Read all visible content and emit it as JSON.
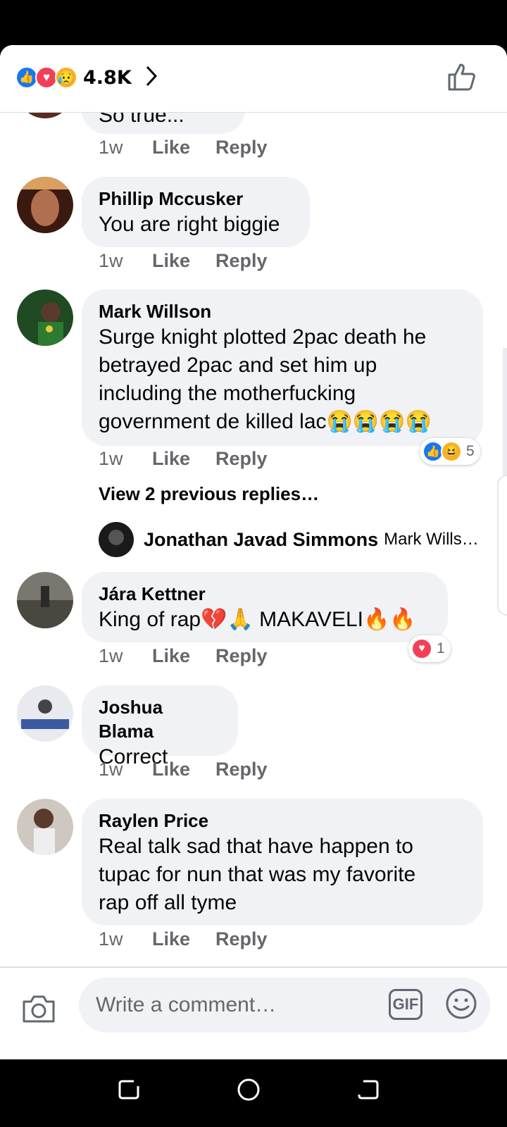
{
  "header": {
    "reaction_count": "4.8K",
    "reactions": [
      "like-icon",
      "love-icon",
      "sad-icon"
    ]
  },
  "comments": [
    {
      "text": "So true...",
      "time": "1w",
      "like": "Like",
      "reply": "Reply"
    },
    {
      "name": "Phillip Mccusker",
      "text": "You are right biggie",
      "time": "1w",
      "like": "Like",
      "reply": "Reply"
    },
    {
      "name": "Mark Willson",
      "text_lines": [
        "Surge knight  plotted 2pac death he",
        "betrayed 2pac and set him up",
        "including the motherfucking",
        "government  de killed lac😭😭😭😭"
      ],
      "time": "1w",
      "like": "Like",
      "reply": "Reply",
      "reaction_count": "5",
      "view_replies": "View 2 previous replies…",
      "reply_preview": {
        "name": "Jonathan Javad Simmons",
        "snippet": "Mark Wills…"
      }
    },
    {
      "name": "Jára Kettner",
      "text": "King of rap💔🙏 MAKAVELI🔥🔥",
      "time": "1w",
      "like": "Like",
      "reply": "Reply",
      "reaction_count": "1"
    },
    {
      "name": "Joshua Blama",
      "text": "Correct",
      "time": "1w",
      "like": "Like",
      "reply": "Reply"
    },
    {
      "name": "Raylen Price",
      "text_lines": [
        "Real talk sad that have happen to",
        "tupac for nun that was my favorite",
        "rap off all tyme"
      ],
      "time": "1w",
      "like": "Like",
      "reply": "Reply"
    }
  ],
  "composer": {
    "placeholder": "Write a comment…",
    "gif_label": "GIF"
  },
  "colors": {
    "like_blue": "#1877f2",
    "love_red": "#f33e58",
    "bubble_gray": "#f0f2f5",
    "meta_gray": "#65676b"
  }
}
